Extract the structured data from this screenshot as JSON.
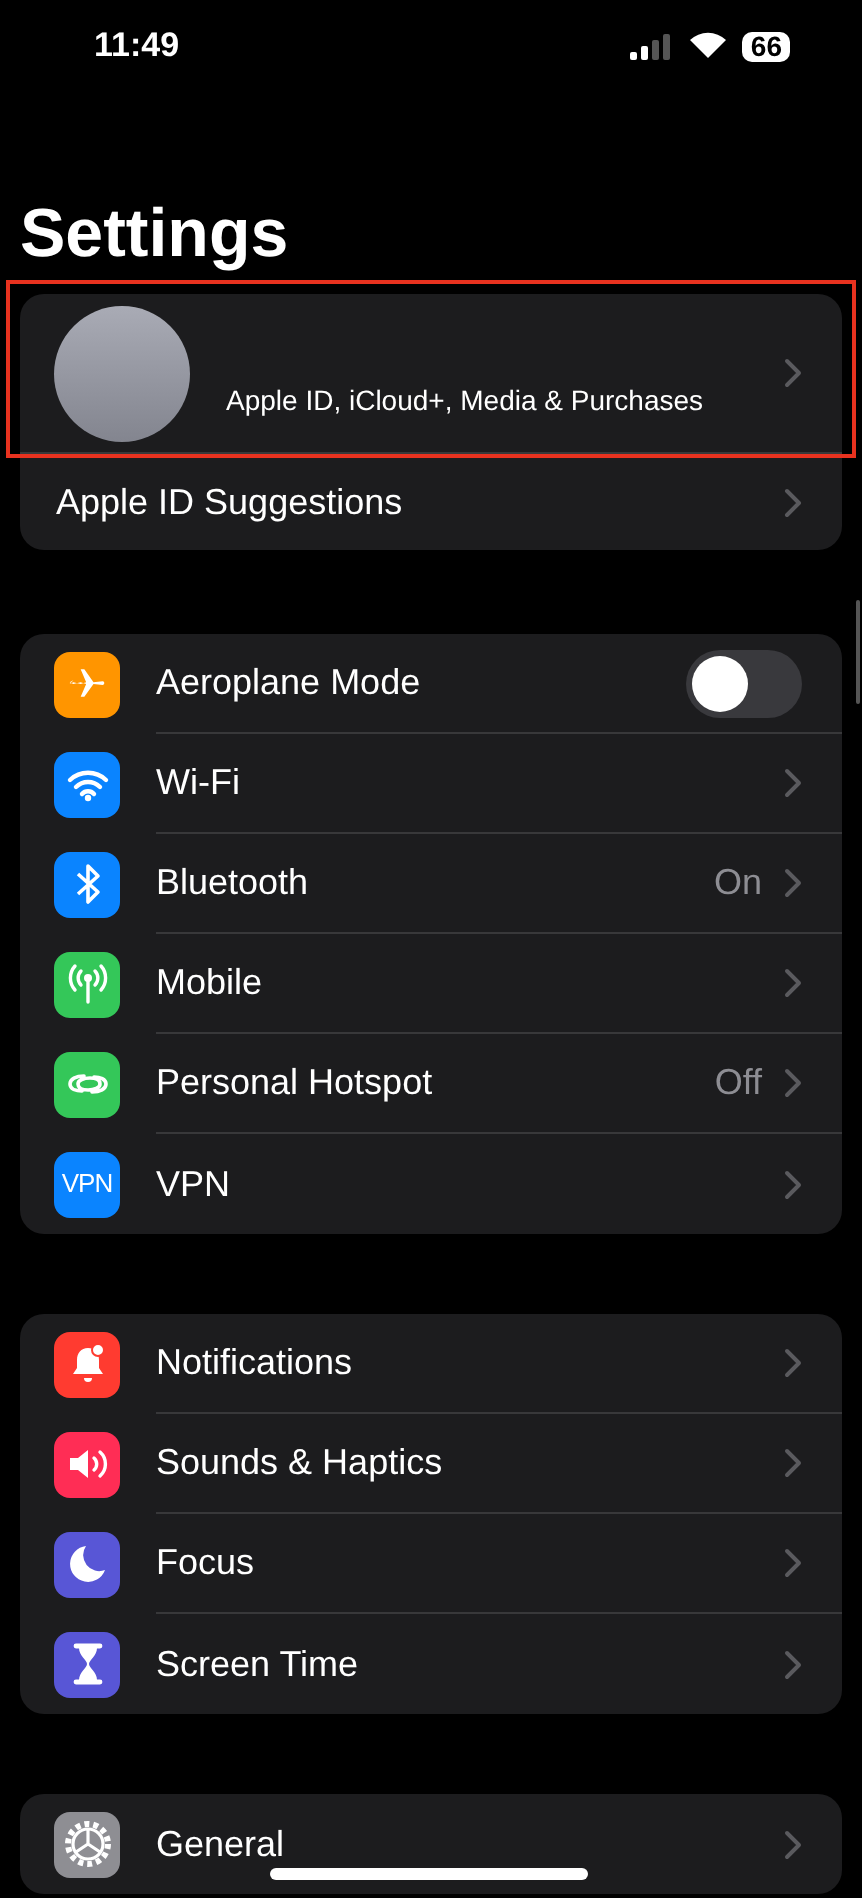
{
  "status_bar": {
    "time": "11:49",
    "battery": "66"
  },
  "title": "Settings",
  "profile": {
    "subtitle": "Apple ID, iCloud+, Media & Purchases",
    "highlighted": true
  },
  "suggestions": {
    "label": "Apple ID Suggestions"
  },
  "groups": [
    {
      "rows": [
        {
          "kind": "toggle",
          "label": "Aeroplane Mode",
          "color": "#ff9500",
          "on": false
        },
        {
          "kind": "link",
          "label": "Wi-Fi",
          "color": "#0a84ff"
        },
        {
          "kind": "link",
          "label": "Bluetooth",
          "color": "#0a84ff",
          "detail": "On"
        },
        {
          "kind": "link",
          "label": "Mobile",
          "color": "#34c759"
        },
        {
          "kind": "link",
          "label": "Personal Hotspot",
          "color": "#34c759",
          "detail": "Off"
        },
        {
          "kind": "link",
          "label": "VPN",
          "color": "#0a84ff",
          "icon_text": "VPN"
        }
      ]
    },
    {
      "rows": [
        {
          "kind": "link",
          "label": "Notifications",
          "color": "#ff3b30"
        },
        {
          "kind": "link",
          "label": "Sounds & Haptics",
          "color": "#ff2d55"
        },
        {
          "kind": "link",
          "label": "Focus",
          "color": "#5856d6"
        },
        {
          "kind": "link",
          "label": "Screen Time",
          "color": "#5856d6"
        }
      ]
    },
    {
      "rows": [
        {
          "kind": "link",
          "label": "General",
          "color": "#8e8e93"
        }
      ]
    }
  ]
}
